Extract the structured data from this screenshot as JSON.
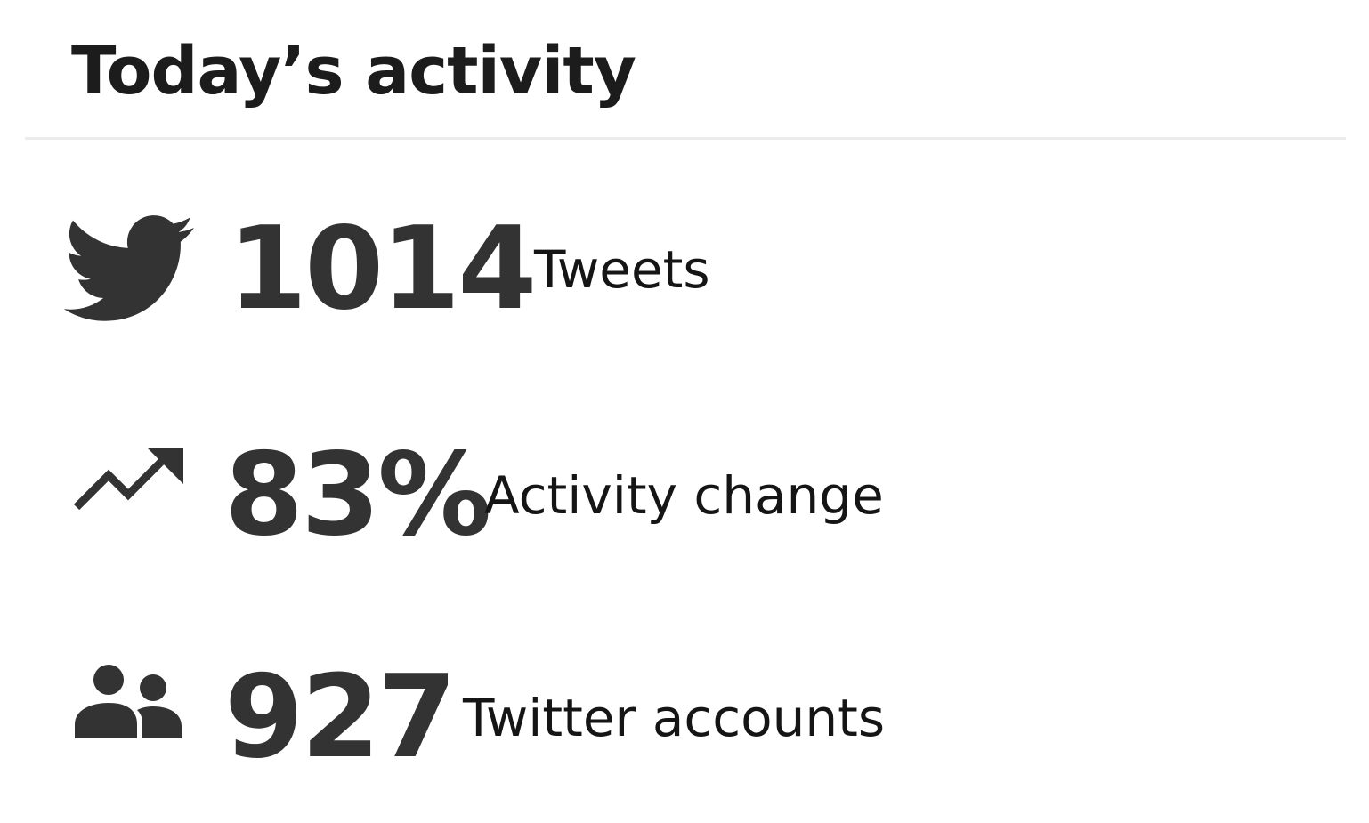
{
  "panel": {
    "title": "Today’s activity"
  },
  "stats": [
    {
      "icon": "twitter-bird-icon",
      "value": "1014",
      "label": "Tweets"
    },
    {
      "icon": "trending-up-icon",
      "value": "83%",
      "label": "Activity change"
    },
    {
      "icon": "people-icon",
      "value": "927",
      "label": "Twitter accounts"
    }
  ],
  "colors": {
    "title": "#1c1c1c",
    "value": "#333333",
    "label": "#151515",
    "icon": "#333333",
    "divider": "#ececec"
  }
}
